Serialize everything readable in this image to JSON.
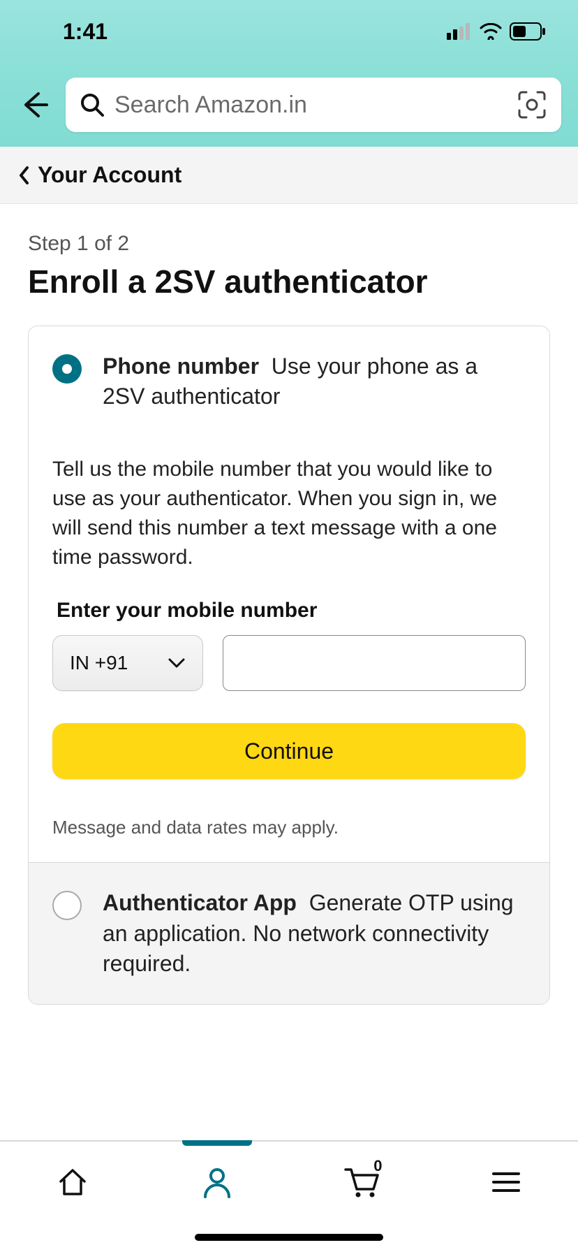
{
  "status": {
    "time": "1:41"
  },
  "search": {
    "placeholder": "Search Amazon.in"
  },
  "breadcrumb": {
    "label": "Your Account"
  },
  "page": {
    "step": "Step 1 of 2",
    "title": "Enroll a 2SV authenticator"
  },
  "options": {
    "phone": {
      "title_bold": "Phone number",
      "title_rest": "Use your phone as a 2SV authenticator",
      "description": "Tell us the mobile number that you would like to use as your authenticator. When you sign in, we will send this number a text message with a one time password.",
      "input_label": "Enter your mobile number",
      "country_code": "IN +91",
      "continue_label": "Continue",
      "rates_note": "Message and data rates may apply."
    },
    "app": {
      "title_bold": "Authenticator App",
      "title_rest": "Generate OTP using an application. No network connectivity required."
    }
  },
  "nav": {
    "cart_count": "0"
  }
}
